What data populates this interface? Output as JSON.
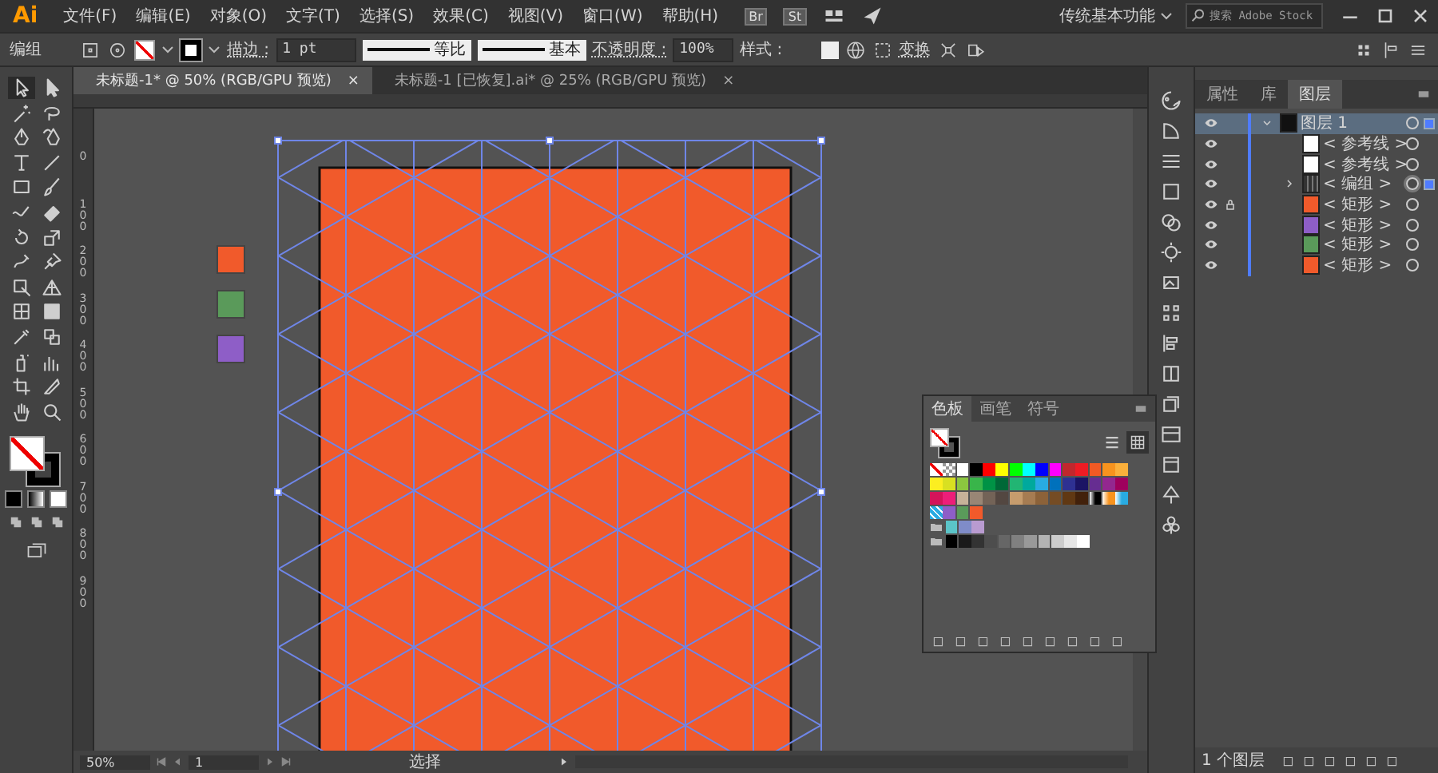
{
  "menu_bar": {
    "logo": "Ai",
    "items": [
      "文件(F)",
      "编辑(E)",
      "对象(O)",
      "文字(T)",
      "选择(S)",
      "效果(C)",
      "视图(V)",
      "窗口(W)",
      "帮助(H)"
    ],
    "app_buttons": [
      "Br",
      "St"
    ],
    "workspace": "传统基本功能",
    "search": {
      "placeholder": "搜索 Adobe Stock"
    }
  },
  "option_bar": {
    "selection_label": "编组",
    "no_fill": true,
    "stroke_label": "描边 :",
    "stroke_weight": "1 pt",
    "profile": "等比",
    "brush": "基本",
    "opacity_label": "不透明度 :",
    "opacity": "100%",
    "style_label": "样式 :",
    "transform": "变换"
  },
  "document_tabs": [
    {
      "title": "未标题-1* @ 50% (RGB/GPU 预览)",
      "close": "×",
      "selected": true
    },
    {
      "title": "未标题-1 [已恢复].ai* @ 25% (RGB/GPU 预览)",
      "close": "×",
      "selected": false
    }
  ],
  "toolbar": {
    "tools": [
      {
        "kind": "selection",
        "selected": true
      },
      {
        "kind": "direct",
        "selected": false
      },
      {
        "kind": "wand",
        "selected": false
      },
      {
        "kind": "lasso",
        "selected": false
      },
      {
        "kind": "pen",
        "selected": false
      },
      {
        "kind": "curvature",
        "selected": false
      },
      {
        "kind": "type",
        "selected": false
      },
      {
        "kind": "line",
        "selected": false
      },
      {
        "kind": "rectangle",
        "selected": false
      },
      {
        "kind": "brush",
        "selected": false
      },
      {
        "kind": "shaper",
        "selected": false
      },
      {
        "kind": "eraser",
        "selected": false
      },
      {
        "kind": "rotate",
        "selected": false
      },
      {
        "kind": "scale",
        "selected": false
      },
      {
        "kind": "warp",
        "selected": false
      },
      {
        "kind": "pin",
        "selected": false
      },
      {
        "kind": "freetransform",
        "selected": false
      },
      {
        "kind": "perspective",
        "selected": false
      },
      {
        "kind": "mesh",
        "selected": false
      },
      {
        "kind": "gradient",
        "selected": false
      },
      {
        "kind": "eyedropper",
        "selected": false
      },
      {
        "kind": "blend",
        "selected": false
      },
      {
        "kind": "sprayer",
        "selected": false
      },
      {
        "kind": "graph",
        "selected": false
      },
      {
        "kind": "artboard",
        "selected": false
      },
      {
        "kind": "slice",
        "selected": false
      },
      {
        "kind": "hand",
        "selected": false
      },
      {
        "kind": "zoom",
        "selected": false
      }
    ],
    "no_fill": true
  },
  "ruler": {
    "labels": [
      "0",
      "100",
      "200",
      "300",
      "400",
      "500",
      "600",
      "700",
      "800",
      "900"
    ]
  },
  "canvas": {
    "rectangle": {
      "color": "#f15a2b"
    },
    "swatches": [
      {
        "color": "#f15a2b"
      },
      {
        "color": "#5a9a5a"
      },
      {
        "color": "#8e5ec7"
      }
    ]
  },
  "status_bar": {
    "zoom": "50%",
    "artboard": "1",
    "tool": "选择"
  },
  "swatches_panel": {
    "tabs": [
      {
        "label": "色板",
        "selected": true
      },
      {
        "label": "画笔",
        "selected": false
      },
      {
        "label": "符号",
        "selected": false
      }
    ],
    "no_fill": true,
    "rows": [
      {
        "kind": "colors",
        "swatches": [
          {
            "kind": "none"
          },
          {
            "kind": "registration"
          },
          {
            "kind": "color",
            "color": "#ffffff"
          },
          {
            "kind": "color",
            "color": "#000000"
          },
          {
            "kind": "color",
            "color": "#ff0000"
          },
          {
            "kind": "color",
            "color": "#ffff00"
          },
          {
            "kind": "color",
            "color": "#00ff00"
          },
          {
            "kind": "color",
            "color": "#00ffff"
          },
          {
            "kind": "color",
            "color": "#0000ff"
          },
          {
            "kind": "color",
            "color": "#ff00ff"
          },
          {
            "kind": "color",
            "color": "#c1272d"
          },
          {
            "kind": "color",
            "color": "#ed1c24"
          },
          {
            "kind": "color",
            "color": "#f15a24"
          },
          {
            "kind": "color",
            "color": "#f7931e"
          },
          {
            "kind": "color",
            "color": "#fbb03b"
          }
        ]
      },
      {
        "kind": "colors",
        "swatches": [
          {
            "kind": "color",
            "color": "#fcee21"
          },
          {
            "kind": "color",
            "color": "#d9e021"
          },
          {
            "kind": "color",
            "color": "#8cc63f"
          },
          {
            "kind": "color",
            "color": "#39b54a"
          },
          {
            "kind": "color",
            "color": "#009245"
          },
          {
            "kind": "color",
            "color": "#006837"
          },
          {
            "kind": "color",
            "color": "#22b573"
          },
          {
            "kind": "color",
            "color": "#00a99d"
          },
          {
            "kind": "color",
            "color": "#29abe2"
          },
          {
            "kind": "color",
            "color": "#0071bc"
          },
          {
            "kind": "color",
            "color": "#2e3192"
          },
          {
            "kind": "color",
            "color": "#1b1464"
          },
          {
            "kind": "color",
            "color": "#662d91"
          },
          {
            "kind": "color",
            "color": "#93278f"
          },
          {
            "kind": "color",
            "color": "#9e005d"
          }
        ]
      },
      {
        "kind": "colors",
        "swatches": [
          {
            "kind": "color",
            "color": "#d4145a"
          },
          {
            "kind": "color",
            "color": "#ed1e79"
          },
          {
            "kind": "color",
            "color": "#c7b299"
          },
          {
            "kind": "color",
            "color": "#998675"
          },
          {
            "kind": "color",
            "color": "#736357"
          },
          {
            "kind": "color",
            "color": "#534741"
          },
          {
            "kind": "color",
            "color": "#c69c6d"
          },
          {
            "kind": "color",
            "color": "#a67c52"
          },
          {
            "kind": "color",
            "color": "#8c6239"
          },
          {
            "kind": "color",
            "color": "#754c24"
          },
          {
            "kind": "color",
            "color": "#603813"
          },
          {
            "kind": "color",
            "color": "#42210b"
          },
          {
            "kind": "gradient",
            "color": "#000000"
          },
          {
            "kind": "gradient",
            "color": "#f7931e"
          },
          {
            "kind": "gradient",
            "color": "#29abe2"
          }
        ]
      },
      {
        "kind": "colors",
        "swatches": [
          {
            "kind": "pattern",
            "color": "#29abe2"
          },
          {
            "kind": "color",
            "color": "#8e5ec7"
          },
          {
            "kind": "color",
            "color": "#5a9a5a"
          },
          {
            "kind": "color",
            "color": "#f15a2b"
          }
        ]
      },
      {
        "kind": "group",
        "swatches": [
          {
            "kind": "color",
            "color": "#5bc4c8"
          },
          {
            "kind": "color",
            "color": "#7f8cc8"
          },
          {
            "kind": "color",
            "color": "#b99bd0"
          }
        ]
      },
      {
        "kind": "group",
        "swatches": [
          {
            "kind": "color",
            "color": "#000000"
          },
          {
            "kind": "color",
            "color": "#1a1a1a"
          },
          {
            "kind": "color",
            "color": "#333333"
          },
          {
            "kind": "color",
            "color": "#4d4d4d"
          },
          {
            "kind": "color",
            "color": "#666666"
          },
          {
            "kind": "color",
            "color": "#808080"
          },
          {
            "kind": "color",
            "color": "#999999"
          },
          {
            "kind": "color",
            "color": "#b3b3b3"
          },
          {
            "kind": "color",
            "color": "#cccccc"
          },
          {
            "kind": "color",
            "color": "#e6e6e6"
          },
          {
            "kind": "color",
            "color": "#ffffff"
          }
        ]
      }
    ]
  },
  "layers_panel": {
    "tabs": [
      {
        "label": "属性",
        "selected": false
      },
      {
        "label": "库",
        "selected": false
      },
      {
        "label": "图层",
        "selected": true
      }
    ],
    "layers": [
      {
        "name": "图层 1",
        "kind": "layer",
        "expanded": true,
        "selected": true,
        "locked": false,
        "art_selected": true,
        "children": [
          {
            "name": "< 参考线 >",
            "kind": "guide",
            "selected": false,
            "locked": false,
            "art_selected": false
          },
          {
            "name": "< 参考线 >",
            "kind": "guide",
            "selected": false,
            "locked": false,
            "art_selected": false
          },
          {
            "name": "< 编组 >",
            "kind": "group",
            "expanded": false,
            "selected": false,
            "locked": false,
            "art_selected": true
          },
          {
            "name": "< 矩形 >",
            "kind": "rect",
            "color": "#f15a2b",
            "selected": false,
            "locked": true,
            "art_selected": false
          },
          {
            "name": "< 矩形 >",
            "kind": "rect",
            "color": "#8e5ec7",
            "selected": false,
            "locked": false,
            "art_selected": false
          },
          {
            "name": "< 矩形 >",
            "kind": "rect",
            "color": "#5a9a5a",
            "selected": false,
            "locked": false,
            "art_selected": false
          },
          {
            "name": "< 矩形 >",
            "kind": "rect",
            "color": "#f15a2b",
            "selected": false,
            "locked": false,
            "art_selected": false
          }
        ]
      }
    ],
    "footer": "1 个图层"
  }
}
